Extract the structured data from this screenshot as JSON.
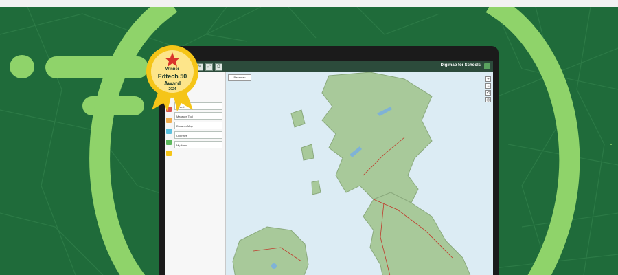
{
  "colors": {
    "background_green": "#1f6b3a",
    "accent_lime": "#8fd36a",
    "badge_gold": "#f5c518",
    "map_water": "#dcecf4",
    "map_land": "#a8c99a"
  },
  "app": {
    "title": "Digimap for Schools",
    "toolbar_buttons": [
      "+",
      "−",
      "⌂",
      "✎",
      "⤢",
      "⎙"
    ],
    "map_tag": "Basemap",
    "sidebar_items": [
      "Search",
      "Measure Tool",
      "Draw on Map",
      "Overlays",
      "My Maps"
    ],
    "sidebar_icon_colors": [
      "#d9534f",
      "#f0ad4e",
      "#5bc0de",
      "#5cb85c",
      "#f5c518"
    ],
    "zoom_buttons": [
      "+",
      "−",
      "⟲",
      "◎"
    ]
  },
  "badge": {
    "label_top": "Winner",
    "label_main": "Edtech 50",
    "label_sub": "Award",
    "label_year": "2024"
  }
}
